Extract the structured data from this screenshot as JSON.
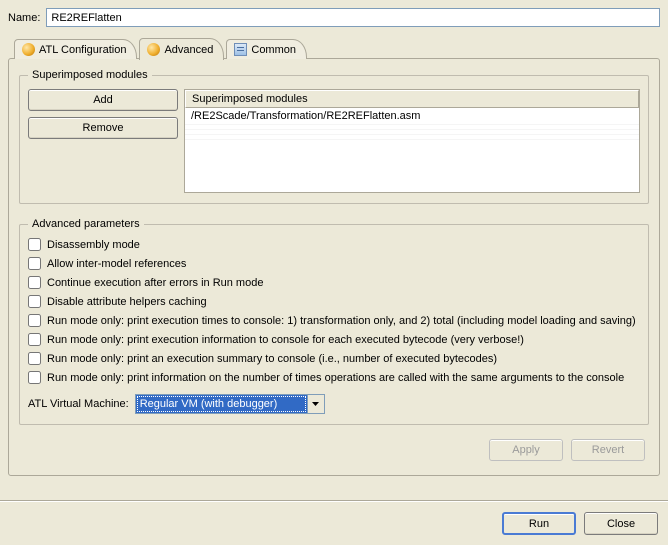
{
  "name_label": "Name:",
  "name_value": "RE2REFlatten",
  "tabs": [
    {
      "label": "ATL Configuration"
    },
    {
      "label": "Advanced"
    },
    {
      "label": "Common"
    }
  ],
  "active_tab": 1,
  "modules": {
    "legend": "Superimposed modules",
    "add_label": "Add",
    "remove_label": "Remove",
    "header": "Superimposed modules",
    "rows": [
      "/RE2Scade/Transformation/RE2REFlatten.asm"
    ]
  },
  "advanced": {
    "legend": "Advanced parameters",
    "checks": [
      {
        "label": "Disassembly mode",
        "checked": false
      },
      {
        "label": "Allow inter-model references",
        "checked": false
      },
      {
        "label": "Continue execution after errors in Run mode",
        "checked": false
      },
      {
        "label": "Disable attribute helpers caching",
        "checked": false
      },
      {
        "label": "Run mode only: print execution times to console: 1) transformation only, and 2) total (including model loading and saving)",
        "checked": false
      },
      {
        "label": "Run mode only: print execution information to console for each executed bytecode (very verbose!)",
        "checked": false
      },
      {
        "label": "Run mode only: print an execution summary to console (i.e., number of executed bytecodes)",
        "checked": false
      },
      {
        "label": "Run mode only: print information on the number of times operations are called with the same arguments to the console",
        "checked": false
      }
    ],
    "vm_label": "ATL Virtual Machine:",
    "vm_value": "Regular VM (with debugger)"
  },
  "buttons": {
    "apply": "Apply",
    "revert": "Revert",
    "run": "Run",
    "close": "Close"
  }
}
